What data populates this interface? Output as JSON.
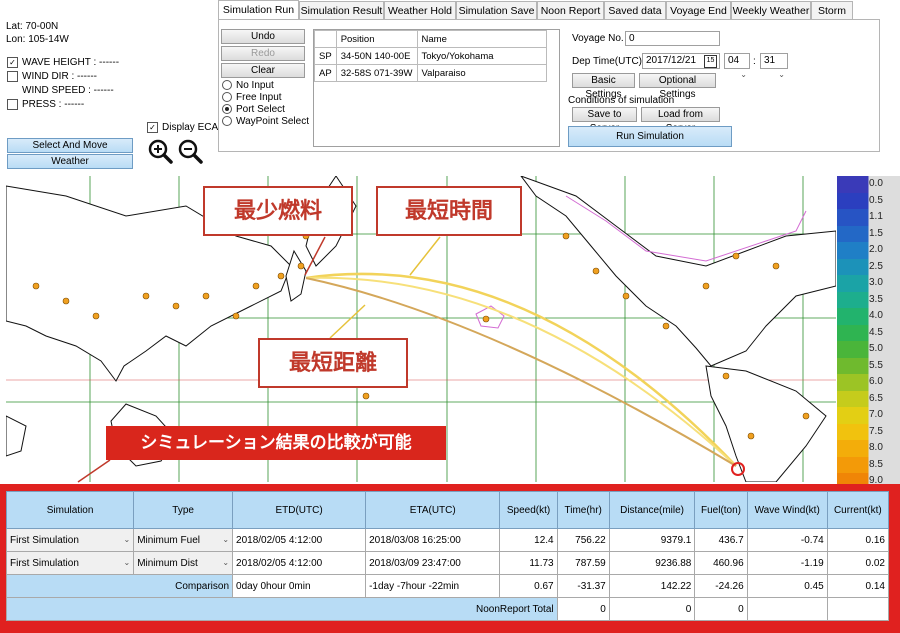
{
  "coords": {
    "lat": "Lat:  70-00N",
    "lon": "Lon:   105-14W"
  },
  "weather_checks": [
    {
      "label": "WAVE HEIGHT : ------",
      "checked": true
    },
    {
      "label": "WIND DIR : ------",
      "checked": false
    },
    {
      "label": "WIND SPEED : ------",
      "checked": false,
      "indent": true
    },
    {
      "label": "PRESS : ------",
      "checked": false
    }
  ],
  "left_buttons": {
    "select_and_move": "Select And Move",
    "weather": "Weather"
  },
  "display_eca": {
    "label": "Display ECA",
    "checked": true
  },
  "tabs": [
    "Simulation Run",
    "Simulation Result",
    "Weather Hold",
    "Simulation Save",
    "Noon Report",
    "Saved data",
    "Voyage End",
    "Weekly Weather",
    "Storm"
  ],
  "edit_buttons": {
    "undo": "Undo",
    "redo": "Redo",
    "clear": "Clear"
  },
  "input_modes": [
    {
      "label": "No Input",
      "selected": false
    },
    {
      "label": "Free Input",
      "selected": false
    },
    {
      "label": "Port Select",
      "selected": true
    },
    {
      "label": "WayPoint Select",
      "selected": false
    }
  ],
  "route_table": {
    "headers": [
      "",
      "Position",
      "Name"
    ],
    "rows": [
      [
        "SP",
        "34-50N 140-00E",
        "Tokyo/Yokohama"
      ],
      [
        "AP",
        "32-58S 071-39W",
        "Valparaiso"
      ]
    ]
  },
  "voyage": {
    "voyage_no_label": "Voyage No.",
    "voyage_no": "0",
    "dep_time_label": "Dep Time(UTC)",
    "dep_date": "2017/12/21",
    "calendar_icon_text": "15",
    "dep_hour": "04",
    "dep_min": "31",
    "basic_settings": "Basic Settings",
    "optional_settings": "Optional Settings",
    "conditions_label": "Conditions of simulation",
    "save_to_server": "Save to Server",
    "load_from_server": "Load from Server",
    "run_simulation": "Run Simulation"
  },
  "callouts": {
    "min_fuel": "最少燃料",
    "min_time": "最短時間",
    "min_dist": "最短距離",
    "compare": "シミュレーション結果の比較が可能"
  },
  "wave_scale": [
    {
      "label": "0.0",
      "color": "#3a3ab8"
    },
    {
      "label": "0.5",
      "color": "#2b3fbf"
    },
    {
      "label": "1.1",
      "color": "#2754c4"
    },
    {
      "label": "1.5",
      "color": "#2368c6"
    },
    {
      "label": "2.0",
      "color": "#1f7fc6"
    },
    {
      "label": "2.5",
      "color": "#1c92b9"
    },
    {
      "label": "3.0",
      "color": "#1ba3a6"
    },
    {
      "label": "3.5",
      "color": "#1dae8d"
    },
    {
      "label": "4.0",
      "color": "#22b36d"
    },
    {
      "label": "4.5",
      "color": "#2fb451"
    },
    {
      "label": "5.0",
      "color": "#4ab53a"
    },
    {
      "label": "5.5",
      "color": "#6fba2e"
    },
    {
      "label": "6.0",
      "color": "#9cc425"
    },
    {
      "label": "6.5",
      "color": "#c5cc1c"
    },
    {
      "label": "7.0",
      "color": "#e3cf14"
    },
    {
      "label": "7.5",
      "color": "#f1c20e"
    },
    {
      "label": "8.0",
      "color": "#f3ad0a"
    },
    {
      "label": "8.5",
      "color": "#f39a08"
    },
    {
      "label": "9.0",
      "color": "#f08506"
    }
  ],
  "results": {
    "headers": [
      "Simulation",
      "Type",
      "ETD(UTC)",
      "ETA(UTC)",
      "Speed(kt)",
      "Time(hr)",
      "Distance(mile)",
      "Fuel(ton)",
      "Wave Wind(kt)",
      "Current(kt)"
    ],
    "rows": [
      [
        "First Simulation",
        "Minimum Fuel",
        "2018/02/05 4:12:00",
        "2018/03/08 16:25:00",
        "12.4",
        "756.22",
        "9379.1",
        "436.7",
        "-0.74",
        "0.16"
      ],
      [
        "First Simulation",
        "Minimum Dist",
        "2018/02/05 4:12:00",
        "2018/03/09 23:47:00",
        "11.73",
        "787.59",
        "9236.88",
        "460.96",
        "-1.19",
        "0.02"
      ]
    ],
    "comparison": {
      "label": "Comparison",
      "etd": "0day 0hour 0min",
      "eta": "-1day -7hour -22min",
      "values": [
        "0.67",
        "-31.37",
        "142.22",
        "-24.26",
        "0.45",
        "0.14"
      ]
    },
    "noon": {
      "label": "NoonReport Total",
      "values": [
        "0",
        "0",
        "0"
      ]
    }
  },
  "colors": {
    "ocean": "#ffffff",
    "land": "#ffffff",
    "grid": "#2e8f2e",
    "route_fuel": "#f2d35a",
    "route_dist": "#d4a75a",
    "highlight": "#e0211f"
  }
}
